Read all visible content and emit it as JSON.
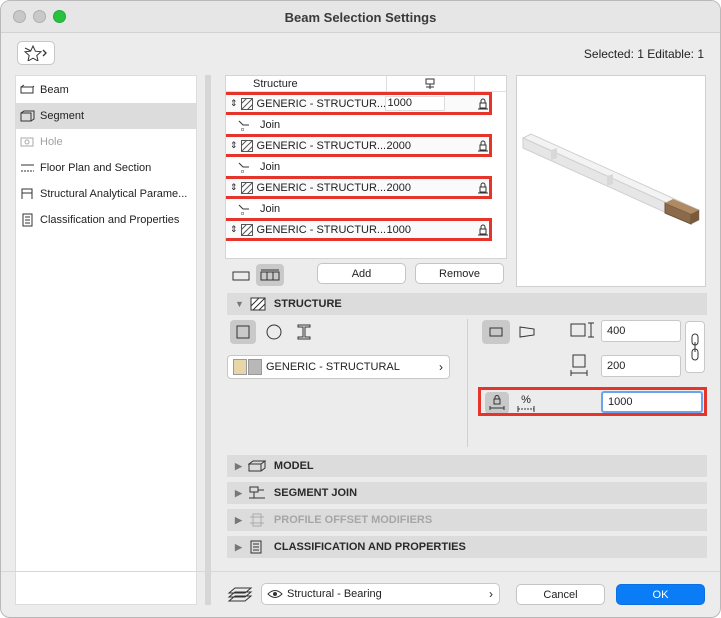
{
  "window": {
    "title": "Beam Selection Settings",
    "colors": {
      "close": "#fe5f57",
      "minimize": "#c8c8c8",
      "zoom": "#29c140",
      "highlight": "#e5342a",
      "accent": "#0a7cf5"
    }
  },
  "header": {
    "selection_info": "Selected: 1 Editable: 1",
    "favorites_icon": "favorites-star-icon"
  },
  "sidebar": {
    "items": [
      {
        "label": "Beam",
        "icon": "beam-icon"
      },
      {
        "label": "Segment",
        "icon": "segment-icon"
      },
      {
        "label": "Hole",
        "icon": "hole-icon"
      },
      {
        "label": "Floor Plan and Section",
        "icon": "floor-plan-icon"
      },
      {
        "label": "Structural Analytical Parame...",
        "icon": "structural-analytical-icon"
      },
      {
        "label": "Classification and Properties",
        "icon": "classification-icon"
      }
    ]
  },
  "segments": {
    "header": "Structure",
    "rows": [
      {
        "material": "GENERIC - STRUCTUR...",
        "length": "1000"
      },
      {
        "material": "GENERIC - STRUCTUR...",
        "length": "2000"
      },
      {
        "material": "GENERIC - STRUCTUR...",
        "length": "2000"
      },
      {
        "material": "GENERIC - STRUCTUR...",
        "length": "1000"
      }
    ],
    "join_label": "Join",
    "add_label": "Add",
    "remove_label": "Remove"
  },
  "structure": {
    "title": "STRUCTURE",
    "material": "GENERIC - STRUCTURAL",
    "width": "400",
    "height": "200",
    "length": "1000",
    "percent_symbol": "%"
  },
  "sections": {
    "model": "MODEL",
    "segment_join": "SEGMENT JOIN",
    "profile_offset": "PROFILE OFFSET MODIFIERS",
    "classification": "CLASSIFICATION AND PROPERTIES"
  },
  "footer": {
    "layer": "Structural - Bearing",
    "cancel": "Cancel",
    "ok": "OK"
  }
}
